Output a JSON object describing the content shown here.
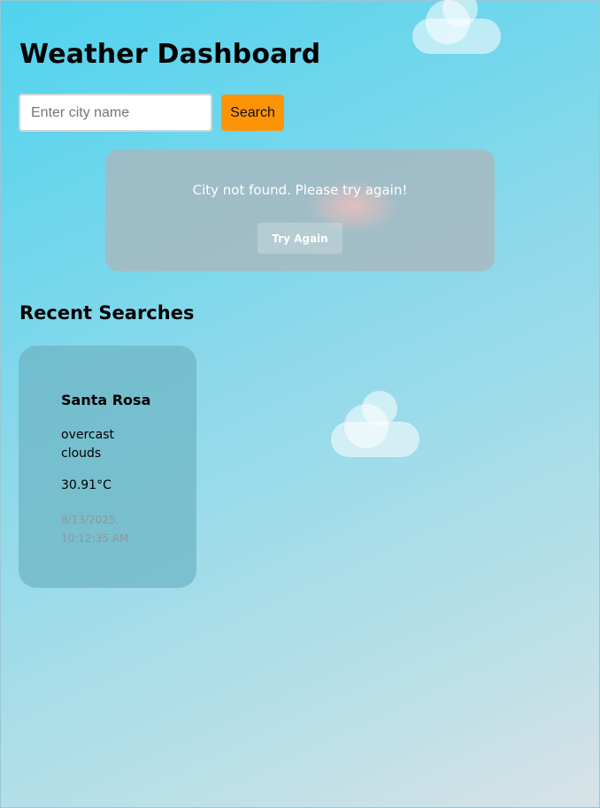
{
  "app": {
    "title": "Weather Dashboard"
  },
  "search": {
    "placeholder": "Enter city name",
    "value": "",
    "button_label": "Search"
  },
  "error": {
    "message": "City not found. Please try again!",
    "retry_label": "Try Again"
  },
  "recent": {
    "heading": "Recent Searches",
    "items": [
      {
        "city": "Santa Rosa",
        "condition": "overcast clouds",
        "temperature": "30.91°C",
        "timestamp": "8/13/2025, 10:12:35 AM"
      }
    ]
  },
  "icons": [
    "cloud-icon"
  ],
  "colors": {
    "accent": "#fd9408",
    "background_start": "#4fd3ee",
    "background_end": "#d7e2e6"
  }
}
